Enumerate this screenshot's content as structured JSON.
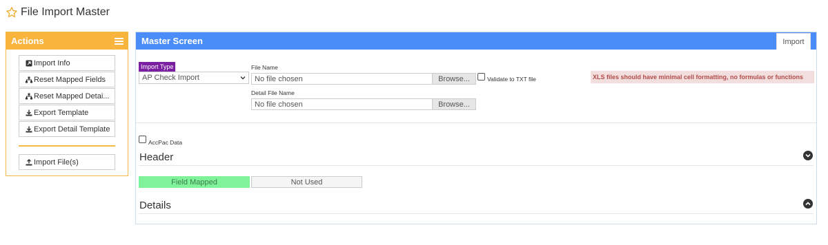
{
  "page": {
    "title": "File Import Master"
  },
  "actions": {
    "title": "Actions",
    "items": [
      {
        "label": "Import Info",
        "icon": "info-icon"
      },
      {
        "label": "Reset Mapped Fields",
        "icon": "sitemap-icon"
      },
      {
        "label": "Reset Mapped Detai...",
        "icon": "sitemap-icon"
      },
      {
        "label": "Export Template",
        "icon": "download-icon"
      },
      {
        "label": "Export Detail Template",
        "icon": "download-icon"
      }
    ],
    "import_files": {
      "label": "Import File(s)",
      "icon": "upload-icon"
    }
  },
  "master": {
    "title": "Master Screen",
    "tab": "Import",
    "import_type": {
      "label": "Import Type",
      "value": "AP Check Import"
    },
    "file_name": {
      "label": "File Name",
      "value": "No file chosen",
      "browse": "Browse..."
    },
    "detail_file_name": {
      "label": "Detail File Name",
      "value": "No file chosen",
      "browse": "Browse..."
    },
    "validate_txt": {
      "label": "Validate to TXT file",
      "checked": false
    },
    "notice": "XLS files should have minimal cell formatting, no formulas or functions",
    "accpac": {
      "label": "AccPac Data",
      "checked": false
    },
    "header_section": {
      "title": "Header",
      "icon": "chevron-down-icon"
    },
    "legend": {
      "mapped": "Field Mapped",
      "unused": "Not Used"
    },
    "details_section": {
      "title": "Details",
      "icon": "chevron-up-icon"
    }
  },
  "colors": {
    "actions_accent": "#f9b43e",
    "master_accent": "#4b8df8",
    "import_type_badge": "#7a1fa2",
    "field_mapped": "#7ff29a",
    "notice_bg": "#f3dede",
    "notice_text": "#b34c4c"
  }
}
